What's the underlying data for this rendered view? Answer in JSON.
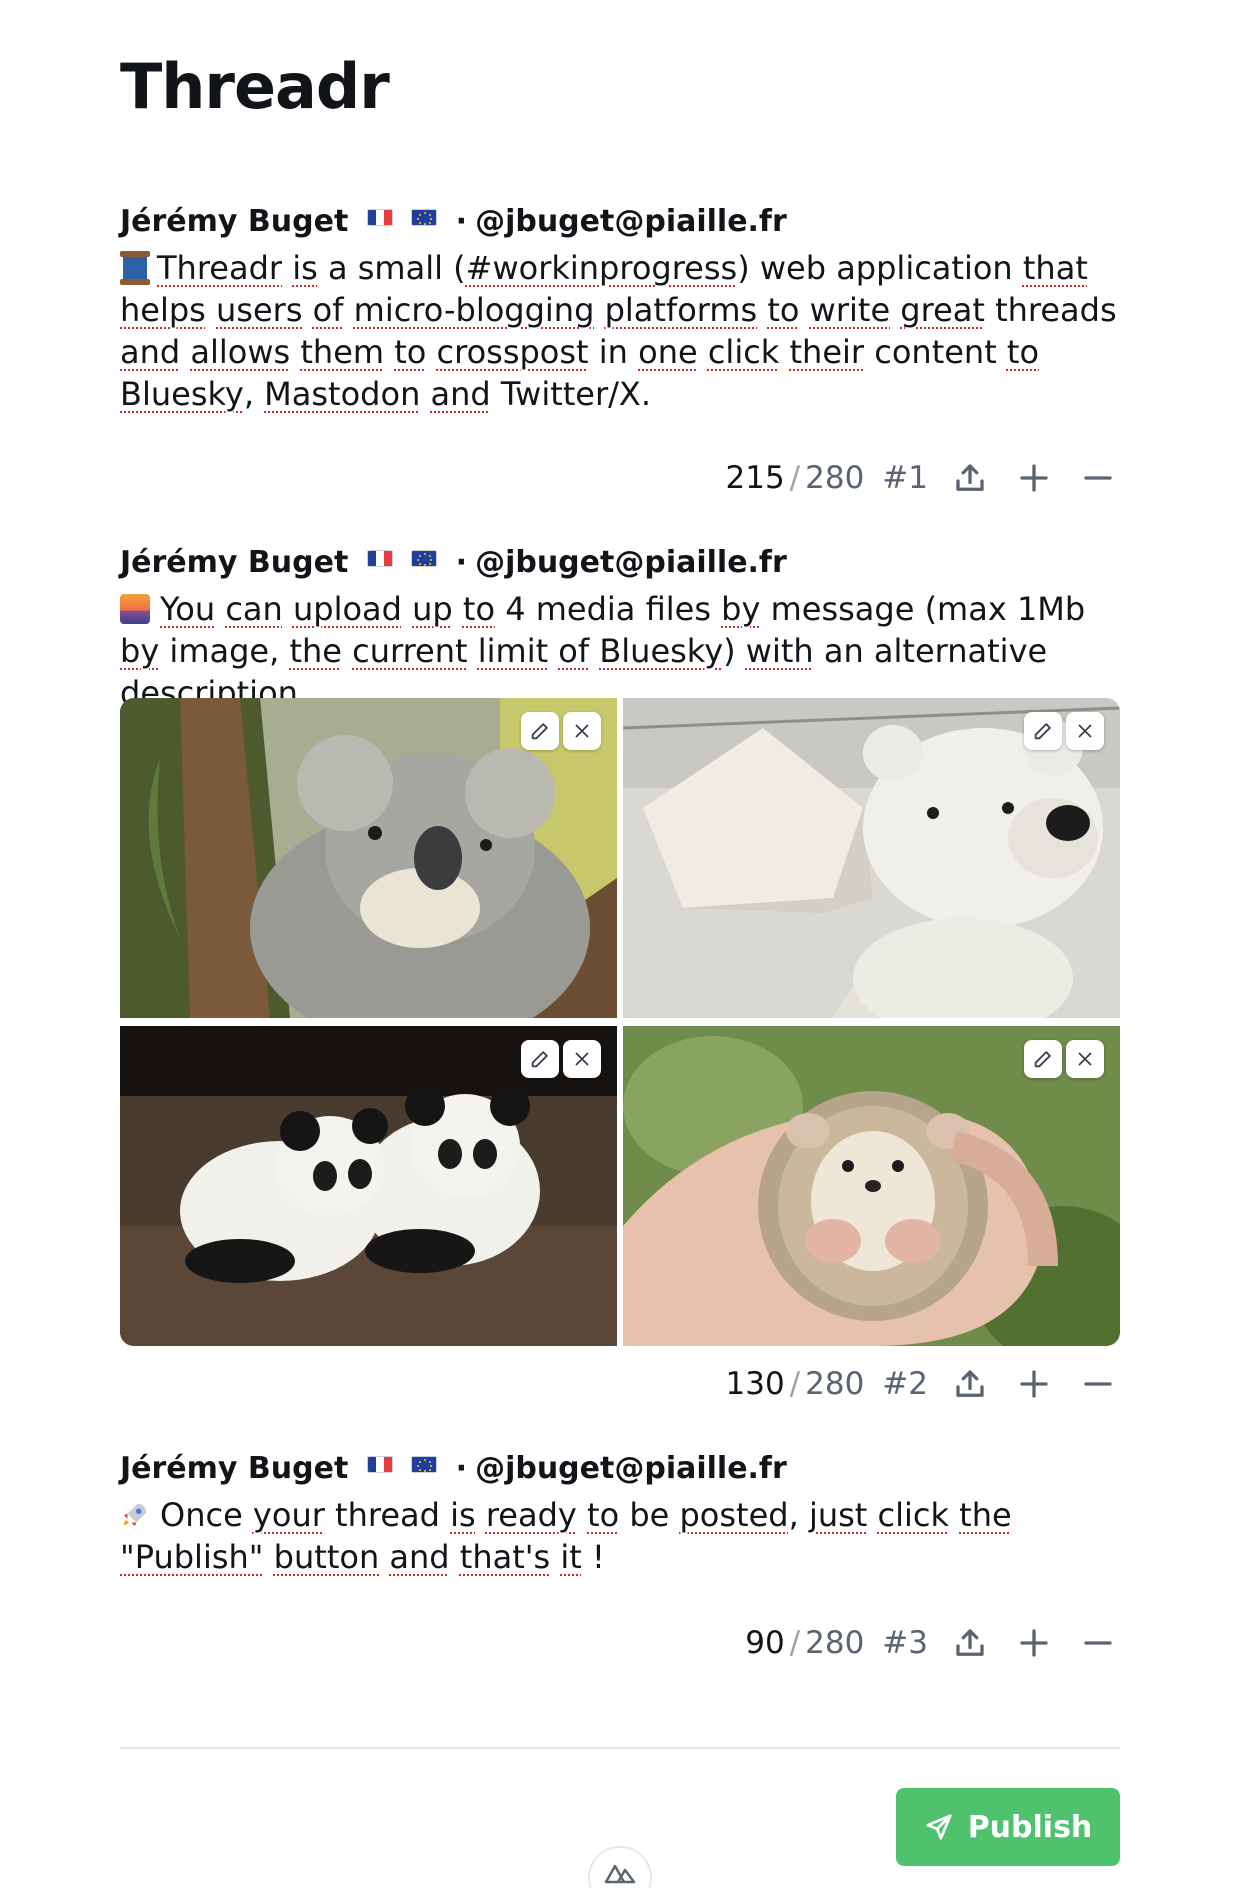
{
  "app": {
    "title": "Threadr"
  },
  "posts": [
    {
      "author_name": "Jérémy Buget",
      "separator": "·",
      "handle": "@jbuget@piaille.fr",
      "emoji": "spool-of-thread-icon",
      "text_segments": [
        {
          "t": "Threadr",
          "u": true
        },
        {
          "t": " ",
          "u": false
        },
        {
          "t": "is",
          "u": true
        },
        {
          "t": " a small (",
          "u": false
        },
        {
          "t": "#workinprogress",
          "u": true
        },
        {
          "t": ") web application ",
          "u": false
        },
        {
          "t": "that",
          "u": true
        },
        {
          "t": " ",
          "u": false
        },
        {
          "t": "helps",
          "u": true
        },
        {
          "t": " ",
          "u": false
        },
        {
          "t": "users",
          "u": true
        },
        {
          "t": " ",
          "u": false
        },
        {
          "t": "of",
          "u": true
        },
        {
          "t": " ",
          "u": false
        },
        {
          "t": "micro-blogging",
          "u": true
        },
        {
          "t": " ",
          "u": false
        },
        {
          "t": "platforms",
          "u": true
        },
        {
          "t": " ",
          "u": false
        },
        {
          "t": "to",
          "u": true
        },
        {
          "t": " ",
          "u": false
        },
        {
          "t": "write",
          "u": true
        },
        {
          "t": " ",
          "u": false
        },
        {
          "t": "great",
          "u": true
        },
        {
          "t": " threads ",
          "u": false
        },
        {
          "t": "and",
          "u": true
        },
        {
          "t": " ",
          "u": false
        },
        {
          "t": "allows",
          "u": true
        },
        {
          "t": " ",
          "u": false
        },
        {
          "t": "them",
          "u": true
        },
        {
          "t": " ",
          "u": false
        },
        {
          "t": "to",
          "u": true
        },
        {
          "t": " ",
          "u": false
        },
        {
          "t": "crosspost",
          "u": true
        },
        {
          "t": " in ",
          "u": false
        },
        {
          "t": "one",
          "u": true
        },
        {
          "t": " ",
          "u": false
        },
        {
          "t": "click",
          "u": true
        },
        {
          "t": " ",
          "u": false
        },
        {
          "t": "their",
          "u": true
        },
        {
          "t": " content ",
          "u": false
        },
        {
          "t": "to",
          "u": true
        },
        {
          "t": " ",
          "u": false
        },
        {
          "t": "Bluesky",
          "u": true
        },
        {
          "t": ", ",
          "u": false
        },
        {
          "t": "Mastodon",
          "u": true
        },
        {
          "t": " ",
          "u": false
        },
        {
          "t": "and",
          "u": true
        },
        {
          "t": " Twitter/X.",
          "u": false
        }
      ],
      "char_count": "215",
      "char_separator": "/",
      "char_limit": "280",
      "index": "#1"
    },
    {
      "author_name": "Jérémy Buget",
      "separator": "·",
      "handle": "@jbuget@piaille.fr",
      "emoji": "sunset-icon",
      "text_segments": [
        {
          "t": "You",
          "u": true
        },
        {
          "t": " ",
          "u": false
        },
        {
          "t": "can",
          "u": true
        },
        {
          "t": " ",
          "u": false
        },
        {
          "t": "upload",
          "u": true
        },
        {
          "t": " ",
          "u": false
        },
        {
          "t": "up",
          "u": true
        },
        {
          "t": " ",
          "u": false
        },
        {
          "t": "to",
          "u": true
        },
        {
          "t": " 4 media files ",
          "u": false
        },
        {
          "t": "by",
          "u": true
        },
        {
          "t": " message (max 1Mb ",
          "u": false
        },
        {
          "t": "by",
          "u": true
        },
        {
          "t": " image, ",
          "u": false
        },
        {
          "t": "the",
          "u": true
        },
        {
          "t": " ",
          "u": false
        },
        {
          "t": "current",
          "u": true
        },
        {
          "t": " ",
          "u": false
        },
        {
          "t": "limit",
          "u": true
        },
        {
          "t": " ",
          "u": false
        },
        {
          "t": "of",
          "u": true
        },
        {
          "t": " ",
          "u": false
        },
        {
          "t": "Bluesky",
          "u": true
        },
        {
          "t": ") ",
          "u": false
        },
        {
          "t": "with",
          "u": true
        },
        {
          "t": " an alternative description.",
          "u": false
        }
      ],
      "media": [
        {
          "subject": "koala",
          "colors": [
            "#c9ccc2",
            "#7f8b5e",
            "#5c6a3a",
            "#b8b7ae"
          ]
        },
        {
          "subject": "polar-bear-cub",
          "colors": [
            "#e9e9e7",
            "#d7d6d0",
            "#f2f1ec",
            "#9ea1a3"
          ]
        },
        {
          "subject": "panda-cubs",
          "colors": [
            "#2b2520",
            "#5a4a3d",
            "#f0efea",
            "#1a1714"
          ]
        },
        {
          "subject": "hedgehog",
          "colors": [
            "#7c9a55",
            "#e3b9a3",
            "#d6c2a6",
            "#4f6b34"
          ]
        }
      ],
      "char_count": "130",
      "char_separator": "/",
      "char_limit": "280",
      "index": "#2"
    },
    {
      "author_name": "Jérémy Buget",
      "separator": "·",
      "handle": "@jbuget@piaille.fr",
      "emoji": "rocket-icon",
      "text_segments": [
        {
          "t": "Once",
          "u": false
        },
        {
          "t": " ",
          "u": false
        },
        {
          "t": "your",
          "u": true
        },
        {
          "t": " thread ",
          "u": false
        },
        {
          "t": "is",
          "u": true
        },
        {
          "t": " ",
          "u": false
        },
        {
          "t": "ready",
          "u": true
        },
        {
          "t": " ",
          "u": false
        },
        {
          "t": "to",
          "u": true
        },
        {
          "t": " be ",
          "u": false
        },
        {
          "t": "posted",
          "u": true
        },
        {
          "t": ", ",
          "u": false
        },
        {
          "t": "just",
          "u": true
        },
        {
          "t": " ",
          "u": false
        },
        {
          "t": "click",
          "u": true
        },
        {
          "t": " ",
          "u": false
        },
        {
          "t": "the",
          "u": true
        },
        {
          "t": " ",
          "u": false
        },
        {
          "t": "\"Publish\"",
          "u": true
        },
        {
          "t": " ",
          "u": false
        },
        {
          "t": "button",
          "u": true
        },
        {
          "t": " ",
          "u": false
        },
        {
          "t": "and",
          "u": true
        },
        {
          "t": " ",
          "u": false
        },
        {
          "t": "that's",
          "u": true
        },
        {
          "t": " ",
          "u": false
        },
        {
          "t": "it",
          "u": true
        },
        {
          "t": " !",
          "u": false
        }
      ],
      "char_count": "90",
      "char_separator": "/",
      "char_limit": "280",
      "index": "#3"
    }
  ],
  "actions": {
    "publish_label": "Publish"
  },
  "colors": {
    "accent": "#4fc26e",
    "text": "#111418",
    "muted": "#5a6372",
    "spellcheck": "#d42828"
  }
}
